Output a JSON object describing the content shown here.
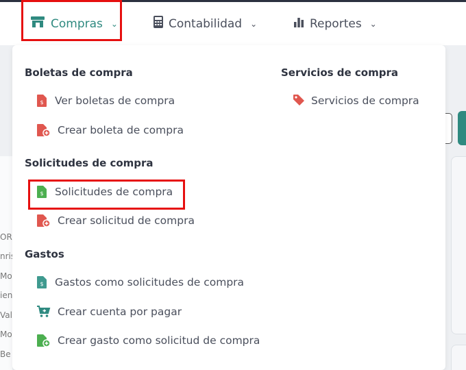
{
  "nav": {
    "items": [
      {
        "label": "Compras",
        "icon": "store-icon",
        "active": true
      },
      {
        "label": "Contabilidad",
        "icon": "calculator-icon",
        "active": false
      },
      {
        "label": "Reportes",
        "icon": "bar-chart-icon",
        "active": false
      }
    ]
  },
  "background": {
    "left_fragments": [
      "OR",
      "nris",
      "Mo",
      "ien",
      "Vall",
      "Mo",
      "Be"
    ]
  },
  "menu": {
    "boletas": {
      "title": "Boletas de compra",
      "items": [
        {
          "label": "Ver boletas de compra",
          "icon": "invoice-icon"
        },
        {
          "label": "Crear boleta de compra",
          "icon": "file-add-icon"
        }
      ]
    },
    "servicios": {
      "title": "Servicios de compra",
      "items": [
        {
          "label": "Servicios de compra",
          "icon": "tag-icon"
        }
      ]
    },
    "solicitudes": {
      "title": "Solicitudes de compra",
      "items": [
        {
          "label": "Solicitudes de compra",
          "icon": "invoice-icon"
        },
        {
          "label": "Crear solicitud de compra",
          "icon": "file-add-icon"
        }
      ]
    },
    "gastos": {
      "title": "Gastos",
      "items": [
        {
          "label": "Gastos como solicitudes de compra",
          "icon": "invoice-icon"
        },
        {
          "label": "Crear cuenta por pagar",
          "icon": "cart-add-icon"
        },
        {
          "label": "Crear gasto como solicitud de compra",
          "icon": "file-add-icon"
        }
      ]
    }
  },
  "colors": {
    "accent": "#2f8a80",
    "red_icon": "#e0574f",
    "green_icon": "#4caf50",
    "highlight": "#e60f0f"
  }
}
